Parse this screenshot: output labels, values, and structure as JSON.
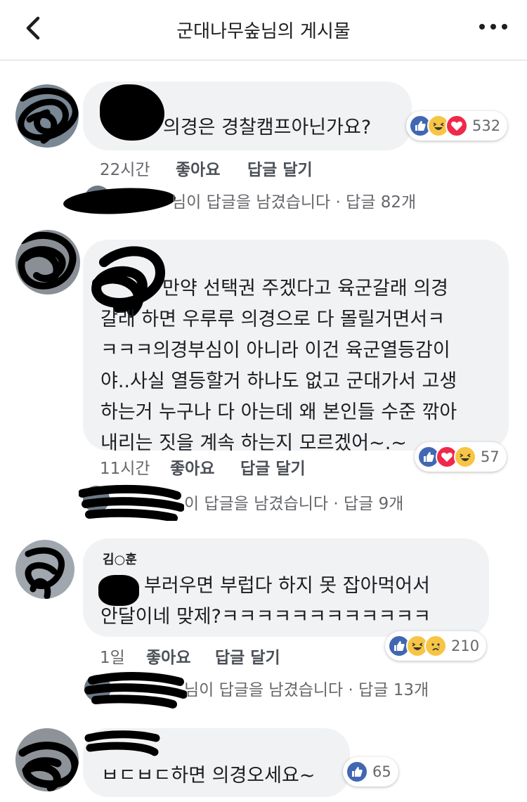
{
  "header": {
    "title": "군대나무숲님의 게시물",
    "back_icon": "chevron-left-icon",
    "more_icon": "more-dots-icon"
  },
  "comments": [
    {
      "author": "",
      "text": "의경은 경찰캠프아닌가요?",
      "time": "22시간",
      "like_label": "좋아요",
      "reply_label": "답글 달기",
      "reactions": [
        "like",
        "haha",
        "love"
      ],
      "reaction_count": "532",
      "replies_summary": "님이 답글을 남겼습니다 · 답글 82개"
    },
    {
      "author": "",
      "text": "만약 선택권 주겠다고 육군갈래 의경\n갈래 하면 우루루 의경으로 다 몰릴거면서ㅋ\nㅋㅋㅋ의경부심이 아니라 이건 육군열등감이\n야..사실 열등할거 하나도 없고 군대가서 고생\n하는거 누구나 다 아는데 왜 본인들 수준 깎아\n내리는 짓을 계속 하는지 모르겠어~.~",
      "time": "11시간",
      "like_label": "좋아요",
      "reply_label": "답글 달기",
      "reactions": [
        "like",
        "love",
        "haha"
      ],
      "reaction_count": "57",
      "replies_summary": "이 답글을 남겼습니다 · 답글 9개"
    },
    {
      "author": "김○훈",
      "text": "부러우면 부럽다 하지 못 잡아먹어서\n안달이네 맞제?ㅋㅋㅋㅋㅋㅋㅋㅋㅋㅋㅋㅋ",
      "time": "1일",
      "like_label": "좋아요",
      "reply_label": "답글 달기",
      "reactions": [
        "like",
        "haha",
        "sad"
      ],
      "reaction_count": "210",
      "replies_summary": "님이 답글을 남겼습니다 · 답글 13개"
    },
    {
      "author": "",
      "text": "ㅂㄷㅂㄷ하면 의경오세요~",
      "reactions": [
        "like"
      ],
      "reaction_count": "65"
    }
  ],
  "colors": {
    "bubble": "#f1f2f4",
    "like": "#4267b2",
    "love": "#f0284a",
    "haha": "#f7c545",
    "meta_text": "#65676b"
  }
}
